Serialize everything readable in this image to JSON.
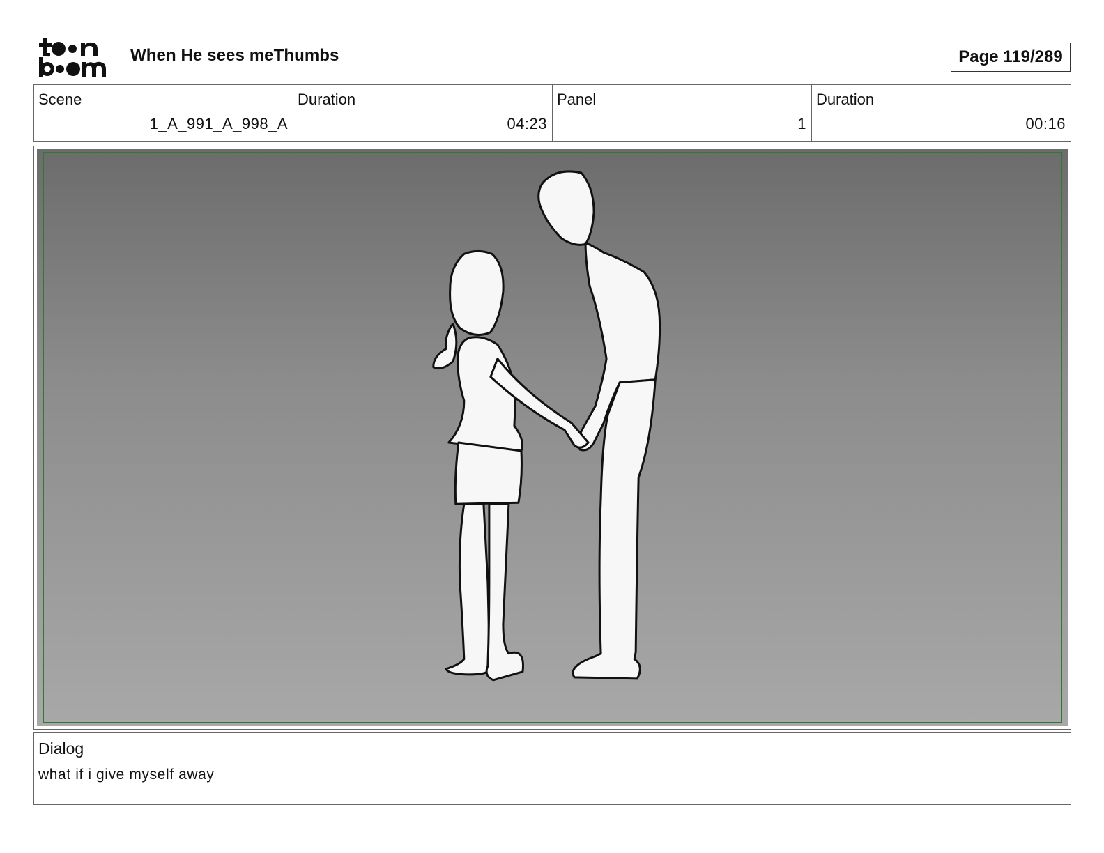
{
  "header": {
    "logo_text": "toon boom",
    "title": "When He sees meThumbs",
    "page": "Page 119/289"
  },
  "info": [
    {
      "label": "Scene",
      "value": "1_A_991_A_998_A"
    },
    {
      "label": "Duration",
      "value": "04:23"
    },
    {
      "label": "Panel",
      "value": "1"
    },
    {
      "label": "Duration",
      "value": "00:16"
    }
  ],
  "panel": {
    "frame_color": "#2f7a2f",
    "background": "grey gradient",
    "image": "sketch-two-figures-holding-hands"
  },
  "dialog": {
    "label": "Dialog",
    "text": "what if i give myself away"
  }
}
